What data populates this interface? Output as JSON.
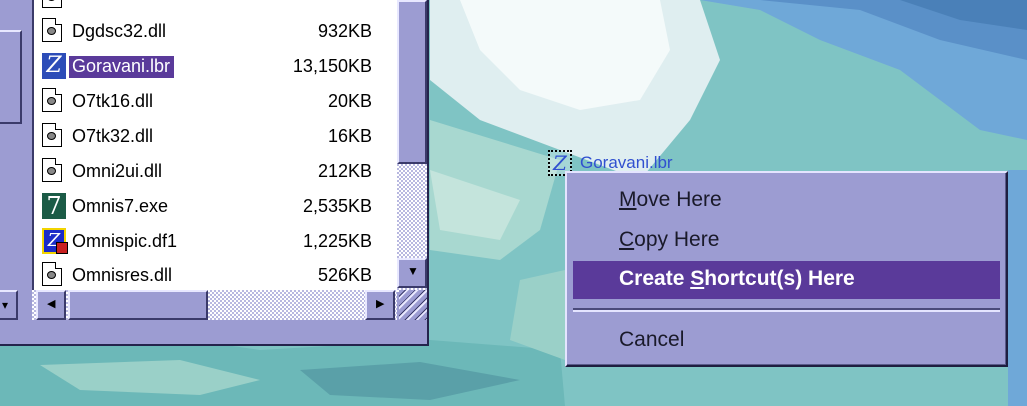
{
  "explorer": {
    "files": [
      {
        "name": "Dgdsc32.dll",
        "size": "932KB",
        "icon": "dll-file-icon"
      },
      {
        "name": "Goravani.lbr",
        "size": "13,150KB",
        "icon": "omnis-library-icon",
        "selected": true
      },
      {
        "name": "O7tk16.dll",
        "size": "20KB",
        "icon": "dll-file-icon"
      },
      {
        "name": "O7tk32.dll",
        "size": "16KB",
        "icon": "dll-file-icon"
      },
      {
        "name": "Omni2ui.dll",
        "size": "212KB",
        "icon": "dll-file-icon"
      },
      {
        "name": "Omnis7.exe",
        "size": "2,535KB",
        "icon": "omnis-exe-icon"
      },
      {
        "name": "Omnispic.df1",
        "size": "1,225KB",
        "icon": "omnis-datafile-icon"
      },
      {
        "name": "Omnisres.dll",
        "size": "526KB",
        "icon": "dll-file-icon"
      }
    ],
    "icon_glyphs": {
      "seven": "7",
      "z": "Z"
    },
    "scroll_glyphs": {
      "down": "▼",
      "left": "◀",
      "right": "▶"
    }
  },
  "drag_ghost": {
    "label": "Goravani.lbr",
    "icon": "omnis-library-icon"
  },
  "context_menu": {
    "items": [
      {
        "pre": "",
        "accel": "M",
        "post": "ove Here",
        "highlighted": false
      },
      {
        "pre": "",
        "accel": "C",
        "post": "opy Here",
        "highlighted": false
      },
      {
        "pre": "Create ",
        "accel": "S",
        "post": "hortcut(s) Here",
        "highlighted": true
      },
      {
        "pre": "Cancel",
        "accel": "",
        "post": "",
        "highlighted": false
      }
    ]
  },
  "colors": {
    "menu_bg": "#9c9cd2",
    "highlight": "#5a3a9a",
    "desktop": "#7fc4c4"
  }
}
